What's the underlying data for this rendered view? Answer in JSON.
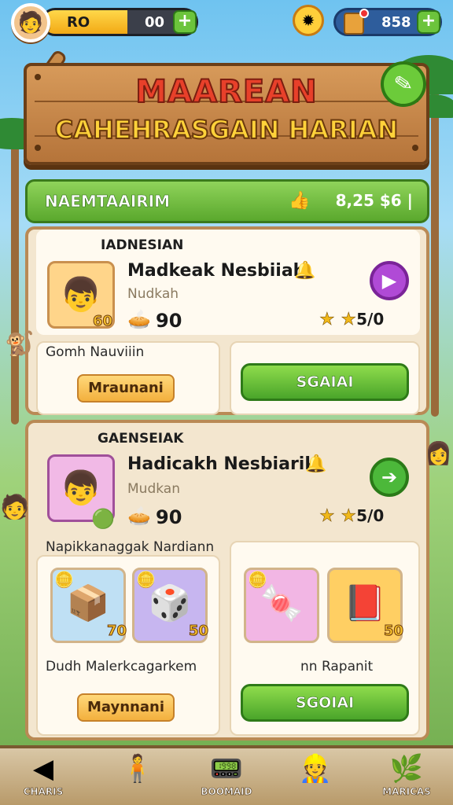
{
  "topbar": {
    "xp_label": "RO",
    "xp_value": "00",
    "xp_fill": 0.55,
    "gem_value": "858",
    "plus": "+"
  },
  "sign": {
    "title": "MAAREAN",
    "subtitle": "CAHEHRASGAIN HARIAN"
  },
  "header": {
    "label": "NAEMTAAIRIM",
    "stat": "8,25 $6 |"
  },
  "panel1": {
    "section": "IADNESIAN",
    "name": "Madkeak Nesbiiah",
    "sub": "Nudkah",
    "badge": "60",
    "count": "90",
    "stars": "★ ★",
    "star_value": "5/0",
    "caption": "Gomh Nauviiin",
    "pill": "Mraunani",
    "button": "SGAIAI"
  },
  "panel2": {
    "section": "GAENSEIAK",
    "name": "Hadicakh Nesbiarik",
    "sub": "Mudkan",
    "count": "90",
    "stars": "★ ★",
    "star_value": "5/0",
    "caption_top": "Napikkanaggak Nardiann",
    "tile1_badge": "70",
    "tile2_badge": "50",
    "tile4_badge": "50",
    "caption_left": "Dudh Malerkcagarkem",
    "caption_right": "nn Rapanit",
    "pill": "Maynnani",
    "button": "SGOIAI"
  },
  "nav": [
    {
      "label": "CHARIS",
      "icon": "arrow-back-icon"
    },
    {
      "label": "",
      "icon": "player-icon"
    },
    {
      "label": "BOOMAID",
      "icon": "device-icon"
    },
    {
      "label": "",
      "icon": "chef-icon"
    },
    {
      "label": "MARICAS",
      "icon": "leaf-icon"
    }
  ],
  "colors": {
    "accent_green": "#5aa82d",
    "sign_wood": "#b5743a",
    "title_red": "#e8402a",
    "title_yellow": "#ffd23a",
    "play_purple": "#b04ad6"
  }
}
